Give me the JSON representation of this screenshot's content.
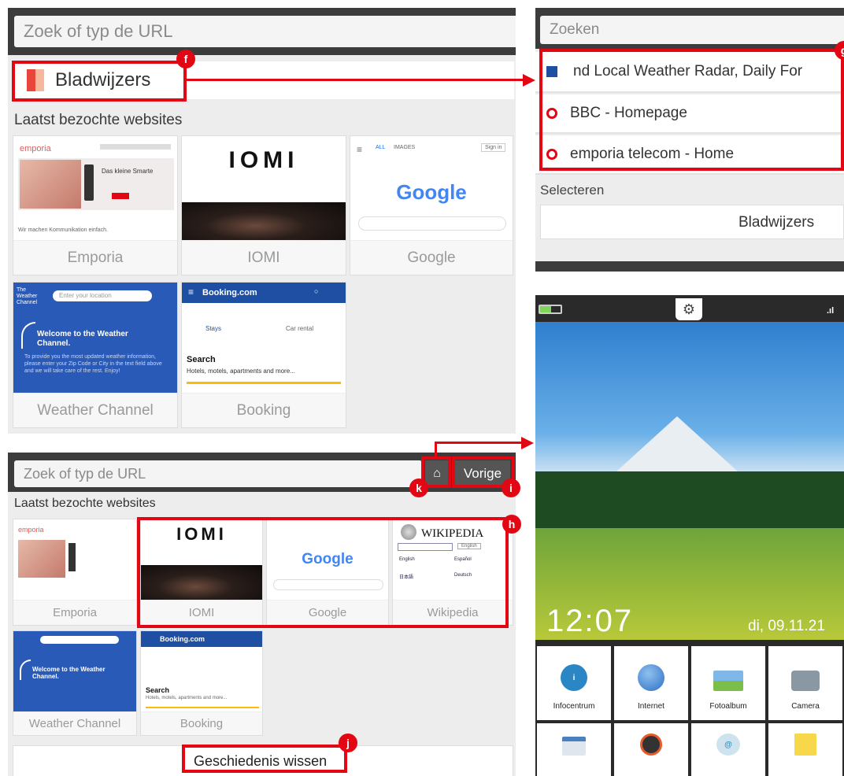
{
  "badges": {
    "f": "f",
    "g": "g",
    "h": "h",
    "i": "i",
    "j": "j",
    "k": "k"
  },
  "panel1": {
    "url_placeholder": "Zoek of typ de URL",
    "bookmarks_label": "Bladwijzers",
    "recent_label": "Laatst bezochte websites",
    "thumbs": [
      {
        "caption": "Emporia",
        "brand": "emporia",
        "headline": "Das kleine Smarte",
        "footer": "Wir machen Kommunikation einfach."
      },
      {
        "caption": "IOMI",
        "brand": "IOMI"
      },
      {
        "caption": "Google",
        "brand": "Google",
        "tab_all": "ALL",
        "tab_images": "IMAGES",
        "signin": "Sign in"
      },
      {
        "caption": "Weather Channel",
        "brand_line1": "The",
        "brand_line2": "Weather",
        "brand_line3": "Channel",
        "location_placeholder": "Enter your location",
        "welcome": "Welcome to the Weather Channel.",
        "body": "To provide you the most updated weather information, please enter your Zip Code or City in the text field above and we will take care of the rest. Enjoy!"
      },
      {
        "caption": "Booking",
        "brand": "Booking.com",
        "stays": "Stays",
        "car_rental": "Car rental",
        "search_title": "Search",
        "search_sub": "Hotels, motels, apartments and more..."
      }
    ]
  },
  "panel2": {
    "search_placeholder": "Zoeken",
    "items": [
      {
        "label": "nd Local Weather Radar, Daily For"
      },
      {
        "label": "BBC - Homepage"
      },
      {
        "label": "emporia telecom - Home"
      }
    ],
    "select_label": "Selecteren",
    "bookmarks_button": "Bladwijzers"
  },
  "panel3": {
    "url_placeholder": "Zoek of typ de URL",
    "back_button": "Vorige",
    "recent_label": "Laatst bezochte websites",
    "thumbs": [
      {
        "caption": "Emporia",
        "brand": "emporia"
      },
      {
        "caption": "IOMI",
        "brand": "IOMI"
      },
      {
        "caption": "Google",
        "brand": "Google"
      },
      {
        "caption": "Wikipedia",
        "brand": "WIKIPEDIA",
        "lang1": "English",
        "lang2": "Español",
        "lang3": "日本語",
        "lang4": "Deutsch",
        "select": "English"
      },
      {
        "caption": "Weather Channel",
        "welcome": "Welcome to the Weather Channel."
      },
      {
        "caption": "Booking",
        "brand": "Booking.com",
        "search_title": "Search",
        "search_sub": "Hotels, motels, apartments and more..."
      }
    ],
    "clear_history": "Geschiedenis wissen"
  },
  "panel4": {
    "time": "12:07",
    "date": "di, 09.11.21",
    "apps": [
      {
        "label": "Infocentrum",
        "icon": "info-icon",
        "color": "#2b86c5"
      },
      {
        "label": "Internet",
        "icon": "globe-icon",
        "color": "#3d7fd6"
      },
      {
        "label": "Fotoalbum",
        "icon": "photo-icon",
        "color": "#e8a33a"
      },
      {
        "label": "Camera",
        "icon": "camera-icon",
        "color": "#6a7c8a"
      }
    ],
    "apps_row2": [
      {
        "icon": "calendar-icon"
      },
      {
        "icon": "alarm-icon"
      },
      {
        "icon": "email-icon"
      },
      {
        "icon": "notes-icon"
      }
    ]
  },
  "colors": {
    "accent": "#e30613",
    "dark": "#3c3c3c",
    "booking": "#1f4fa3",
    "weather": "#2a5ab8"
  }
}
